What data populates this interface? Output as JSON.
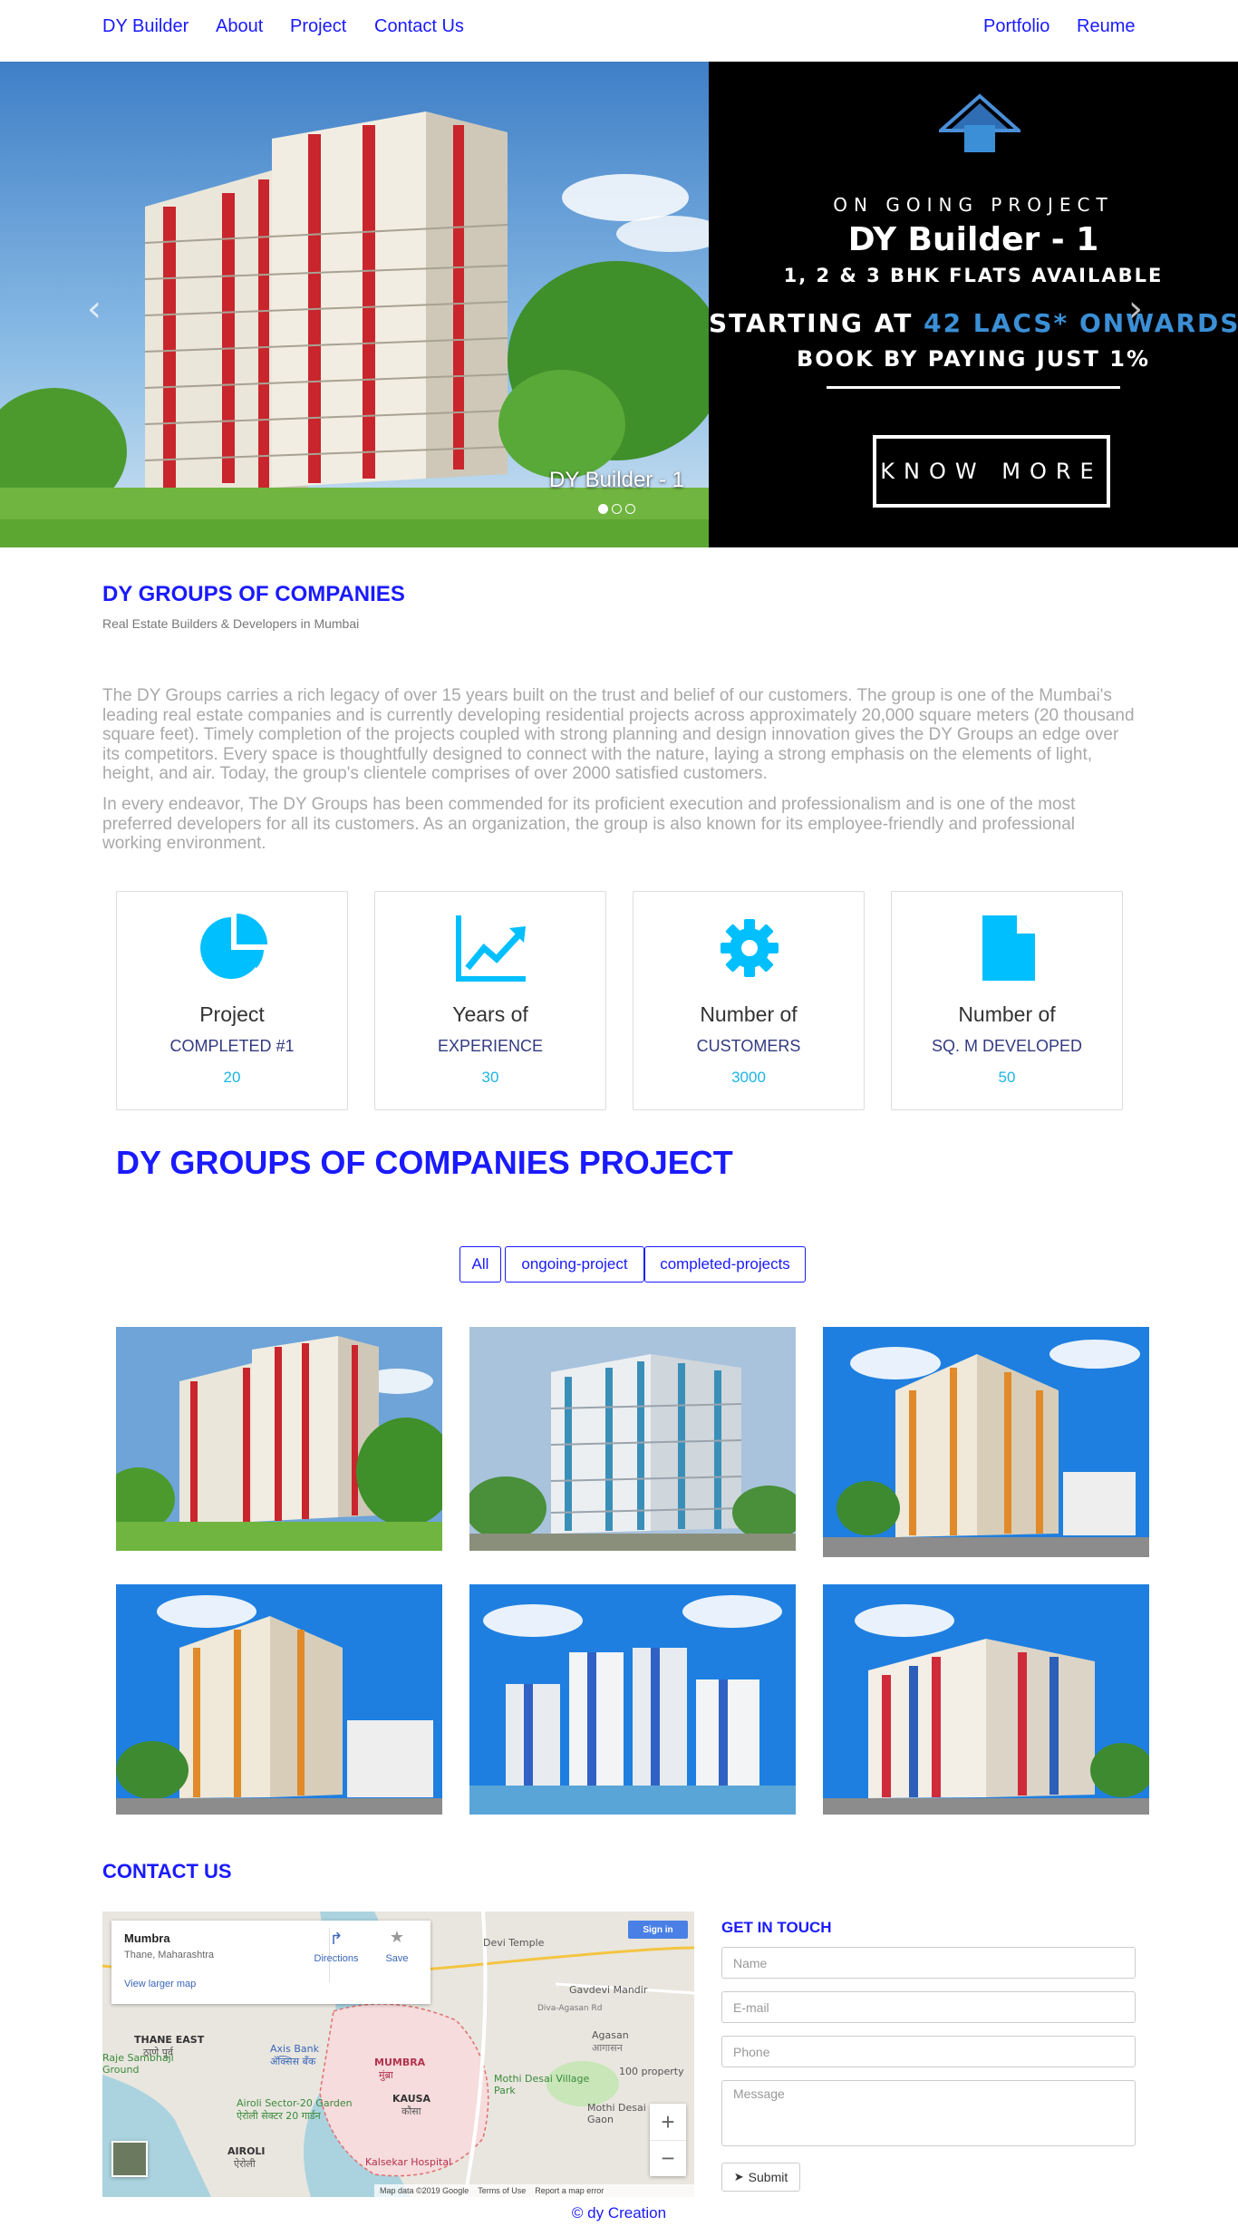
{
  "nav": {
    "brand": "DY Builder",
    "links": [
      "About",
      "Project",
      "Contact Us"
    ],
    "right_links": [
      "Portfolio",
      "Reume"
    ]
  },
  "hero": {
    "tagline": "ON GOING PROJECT",
    "project_name": "DY Builder - 1",
    "flats": "1, 2 & 3 BHK FLATS AVAILABLE",
    "price_prefix": "STARTING AT ",
    "price_highlight": "42 LACS* ONWARDS",
    "booking": "BOOK BY PAYING JUST 1%",
    "cta": "KNOW MORE",
    "caption": "DY Builder - 1",
    "prev_glyph": "‹",
    "next_glyph": "›",
    "slides_total": 3,
    "active_slide": 1
  },
  "about": {
    "title": "DY GROUPS OF COMPANIES",
    "subtitle": "Real Estate Builders & Developers in Mumbai",
    "paragraph1": "The DY Groups carries a rich legacy of over 15 years built on the trust and belief of our customers. The group is one of the Mumbai's leading real estate companies and is currently developing residential projects across approximately 20,000 square meters (20 thousand square feet). Timely completion of the projects coupled with strong planning and design innovation gives the DY Groups an edge over its competitors. Every space is thoughtfully designed to connect with the nature, laying a strong emphasis on the elements of light, height, and air. Today, the group's clientele comprises of over 2000 satisfied customers.",
    "paragraph2": "In every endeavor, The DY Groups has been commended for its proficient execution and professionalism and is one of the most preferred developers for all its customers. As an organization, the group is also known for its employee-friendly and professional working environment."
  },
  "stats": [
    {
      "icon": "pie-chart-icon",
      "title": "Project",
      "subtitle": "COMPLETED #1",
      "value": "20"
    },
    {
      "icon": "line-chart-icon",
      "title": "Years of",
      "subtitle": "EXPERIENCE",
      "value": "30"
    },
    {
      "icon": "gear-icon",
      "title": "Number of",
      "subtitle": "CUSTOMERS",
      "value": "3000"
    },
    {
      "icon": "document-icon",
      "title": "Number of",
      "subtitle": "SQ. M DEVELOPED",
      "value": "50"
    }
  ],
  "projects": {
    "title": "DY GROUPS OF COMPANIES PROJECT",
    "filters": [
      "All",
      "ongoing-project",
      "completed-projects"
    ]
  },
  "contact": {
    "title": "CONTACT US",
    "map": {
      "place_name": "Mumbra",
      "place_region": "Thane, Maharashtra",
      "view_larger": "View larger map",
      "directions": "Directions",
      "save": "Save",
      "sign_in": "Sign in",
      "attribution": "Map data ©2019 Google",
      "terms": "Terms of Use",
      "report": "Report a map error",
      "labels": [
        "Devi Temple",
        "Gavdevi Mandir",
        "Agasan",
        "आगासन",
        "THANE EAST",
        "ठाणे पूर्व",
        "Axis Bank",
        "अ‍ॅक्सिस बँक",
        "MUMBRA",
        "मुंब्रा",
        "KAUSA",
        "कौसा",
        "Mothi Desai Village Park",
        "Airoli Sector-20 Garden",
        "ऐरोली सेक्टर 20 गार्डन",
        "Raje Sambhaji Ground",
        "AIROLI",
        "ऐरोली",
        "Kalsekar Hospital",
        "Mothi Desai Gaon",
        "100 property",
        "Diva-Agasan Rd"
      ]
    },
    "form": {
      "title": "GET IN TOUCH",
      "name_placeholder": "Name",
      "email_placeholder": "E-mail",
      "phone_placeholder": "Phone",
      "message_placeholder": "Message",
      "submit": "Submit"
    }
  },
  "footer": "© dy Creation",
  "colors": {
    "link_blue": "#1a1aff",
    "accent_cyan": "#00bfff",
    "price_highlight": "#3a8fd6",
    "paragraph_gray": "#a9a9a9"
  }
}
